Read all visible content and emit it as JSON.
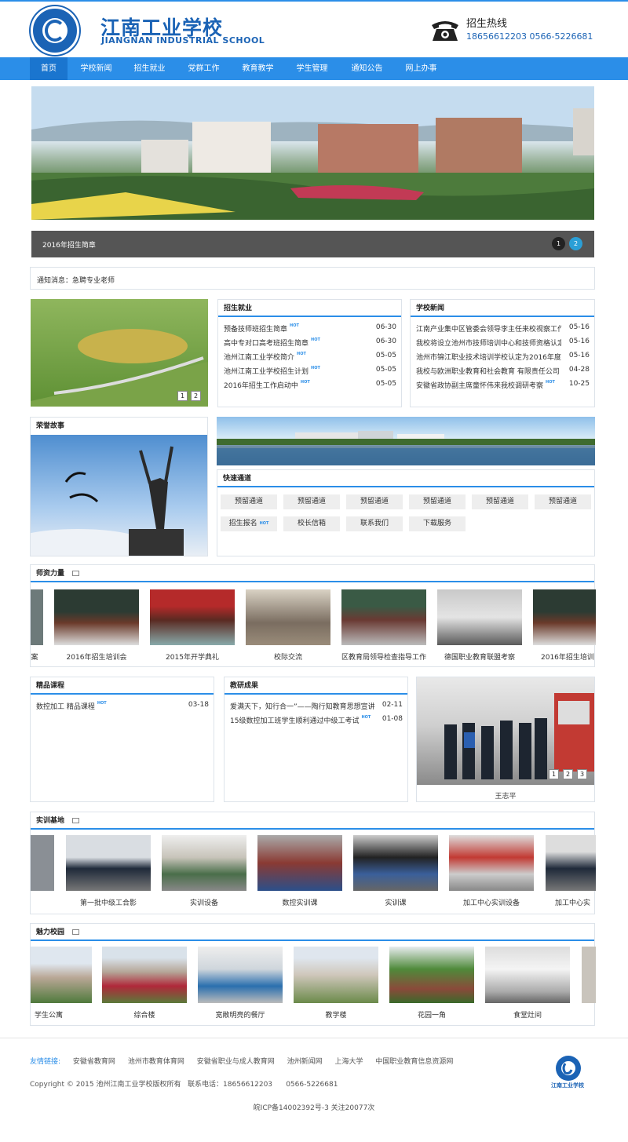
{
  "header": {
    "school_cn": "江南工业学校",
    "school_en": "JIANGNAN INDUSTRIAL SCHOOL",
    "hotline_title": "招生热线",
    "hotline_numbers": "18656612203   0566-5226681",
    "brand_color": "#1b63b5"
  },
  "nav": {
    "items": [
      "首页",
      "学校新闻",
      "招生就业",
      "党群工作",
      "教育教学",
      "学生管理",
      "通知公告",
      "网上办事"
    ],
    "active": "首页",
    "bar_color": "#2b8ee8"
  },
  "banner": {
    "caption": "2016年招生简章",
    "dots": [
      "1",
      "2"
    ],
    "active_dot": "2"
  },
  "notice": {
    "text": "通知消息：急聘专业老师"
  },
  "slider1": {
    "buttons": [
      "1",
      "2"
    ]
  },
  "admission": {
    "title": "招生就业",
    "rows": [
      {
        "title": "预备技师班招生简章",
        "hot": "HOT",
        "date": "06-30"
      },
      {
        "title": "高中专对口高考班招生简章",
        "hot": "HOT",
        "date": "06-30"
      },
      {
        "title": "池州江南工业学校简介",
        "hot": "HOT",
        "date": "05-05"
      },
      {
        "title": "池州江南工业学校招生计划",
        "hot": "HOT",
        "date": "05-05"
      },
      {
        "title": "2016年招生工作启动中",
        "hot": "HOT",
        "date": "05-05"
      }
    ]
  },
  "school_news": {
    "title": "学校新闻",
    "rows": [
      {
        "title": "江南产业集中区管委会领导李主任来校视察工作",
        "date": "05-16"
      },
      {
        "title": "我校将设立池州市技师培训中心和技师资格认定",
        "date": "05-16"
      },
      {
        "title": "池州市锦江职业技术培训学校认定为2016年度",
        "date": "05-16"
      },
      {
        "title": "我校与欧洲职业教育和社会教育 有限责任公司",
        "date": "04-28"
      },
      {
        "title": "安徽省政协副主席童怀伟来我校调研考察",
        "hot": "HOT",
        "date": "10-25"
      }
    ]
  },
  "honor": {
    "title": "荣誉故事"
  },
  "quick": {
    "title": "快速通道",
    "row1": [
      "预留通道",
      "预留通道",
      "预留通道",
      "预留通道",
      "预留通道",
      "预留通道"
    ],
    "row2": [
      {
        "label": "招生报名",
        "hot": "HOT"
      },
      {
        "label": "校长信箱"
      },
      {
        "label": "联系我们"
      },
      {
        "label": "下载服务"
      }
    ]
  },
  "teachers": {
    "title": "师资力量",
    "captions": [
      "案",
      "2016年招生培训会",
      "2015年开学典礼",
      "校际交流",
      "区教育局领导检查指导工作",
      "德国职业教育联盟考察",
      "2016年招生培训"
    ]
  },
  "courses": {
    "title": "精品课程",
    "rows": [
      {
        "title": "数控加工 精品课程",
        "hot": "HOT",
        "date": "03-18"
      }
    ]
  },
  "research": {
    "title": "教研成果",
    "rows": [
      {
        "title": "爱满天下，知行合一”——陶行知教育思想宣讲",
        "date": "02-11"
      },
      {
        "title": "15级数控加工班学生顺利通过中级工考试",
        "hot": "HOT",
        "date": "01-08"
      }
    ]
  },
  "featured": {
    "caption": "王志平",
    "buttons": [
      "1",
      "2",
      "3"
    ]
  },
  "training": {
    "title": "实训基地",
    "captions": [
      "第一批中级工合影",
      "实训设备",
      "数控实训课",
      "实训课",
      "加工中心实训设备",
      "加工中心实"
    ]
  },
  "campus": {
    "title": "魅力校园",
    "captions": [
      "学生公寓",
      "综合楼",
      "宽敞明亮的餐厅",
      "教学楼",
      "花园一角",
      "食堂灶间"
    ]
  },
  "footer": {
    "links_label": "友情链接:",
    "links": [
      "安徽省教育网",
      "池州市教育体育网",
      "安徽省职业与成人教育网",
      "池州新闻网",
      "上海大学",
      "中国职业教育信息资源网"
    ],
    "copyright": "Copyright © 2015 池州江南工业学校版权所有   联系电话：18656612203      0566-5226681",
    "icp": "皖ICP备14002392号-3    关注20077次",
    "logo_text": "江南工业学校"
  }
}
